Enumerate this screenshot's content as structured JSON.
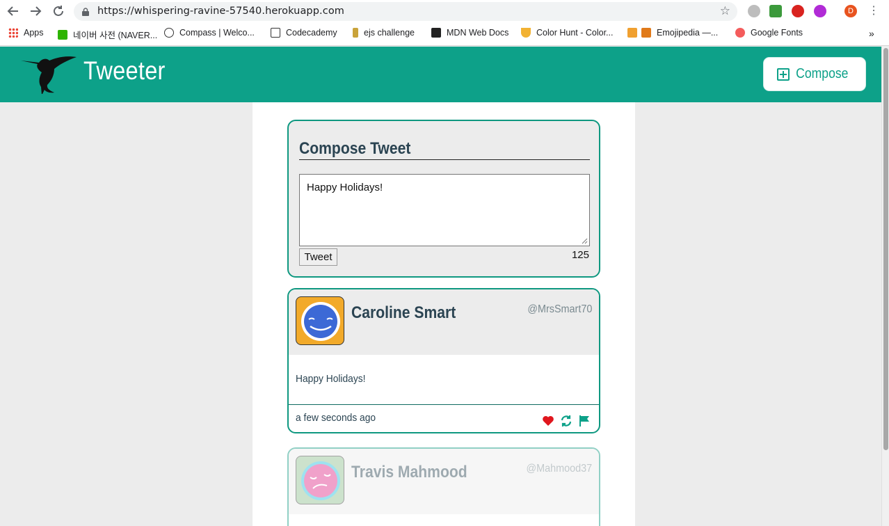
{
  "browser": {
    "url": "https://whispering-ravine-57540.herokuapp.com",
    "bookmarks": [
      {
        "label": "Apps"
      },
      {
        "label": "네이버 사전 (NAVER..."
      },
      {
        "label": "Compass | Welco..."
      },
      {
        "label": "Codecademy"
      },
      {
        "label": "ejs challenge"
      },
      {
        "label": "MDN Web Docs"
      },
      {
        "label": "Color Hunt - Color..."
      },
      {
        "label": "Emojipedia —..."
      },
      {
        "label": "Google Fonts"
      }
    ],
    "profile_initial": "D"
  },
  "header": {
    "title": "Tweeter",
    "compose_label": "Compose"
  },
  "compose": {
    "heading": "Compose Tweet",
    "text": "Happy Holidays!",
    "tweet_button": "Tweet",
    "counter": "125"
  },
  "tweets": [
    {
      "name": "Caroline Smart",
      "handle": "@MrsSmart70",
      "body": "Happy Holidays!",
      "time": "a few seconds ago"
    },
    {
      "name": "Travis Mahmood",
      "handle": "@Mahmood37"
    }
  ],
  "colors": {
    "brand": "#0da189",
    "heading": "#2b4452",
    "like": "#e0161d"
  }
}
